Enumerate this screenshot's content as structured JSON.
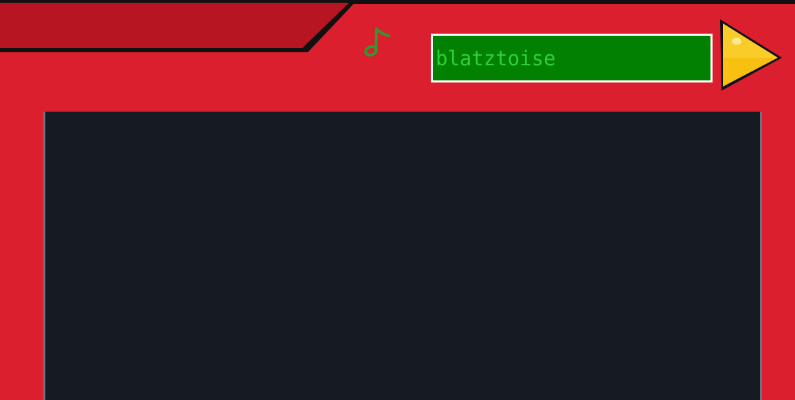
{
  "search": {
    "value": "blatztoise",
    "placeholder": ""
  },
  "icons": {
    "music": "music-note-icon",
    "go": "play-triangle-icon"
  },
  "colors": {
    "frame": "#db1f2e",
    "tab": "#b81522",
    "search_bg": "#028002",
    "search_text": "#2ed03a",
    "search_border": "#ffffff",
    "go_button": "#f8c010",
    "screen": "#151b21",
    "music_icon": "#2e9a2e"
  }
}
